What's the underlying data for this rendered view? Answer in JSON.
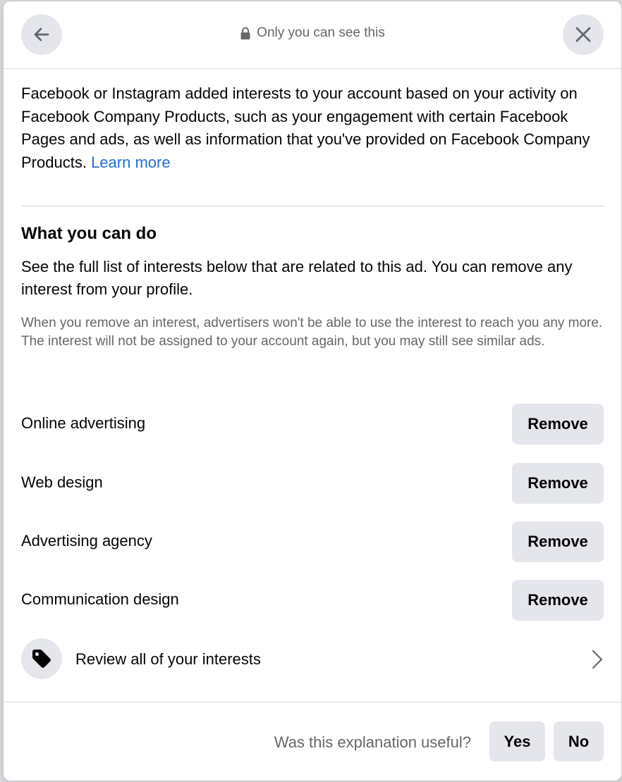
{
  "header": {
    "title": "Only you can see this",
    "icons": {
      "back": "arrow-left-icon",
      "lock": "lock-icon",
      "close": "close-icon"
    }
  },
  "intro": {
    "text": "Facebook or Instagram added interests to your account based on your activity on Facebook Company Products, such as your engagement with certain Facebook Pages and ads, as well as information that you've provided on Facebook Company Products.",
    "link": "Learn more"
  },
  "what_you_can_do": {
    "title": "What you can do",
    "description": "See the full list of interests below that are related to this ad. You can remove any interest from your profile.",
    "note": "When you remove an interest, advertisers won't be able to use the interest to reach you any more. The interest will not be assigned to your account again, but you may still see similar ads."
  },
  "interests": [
    {
      "label": "Online advertising",
      "button": "Remove"
    },
    {
      "label": "Web design",
      "button": "Remove"
    },
    {
      "label": "Advertising agency",
      "button": "Remove"
    },
    {
      "label": "Communication design",
      "button": "Remove"
    }
  ],
  "review": {
    "label": "Review all of your interests",
    "icon": "tag-icon"
  },
  "footer": {
    "question": "Was this explanation useful?",
    "yes": "Yes",
    "no": "No"
  },
  "colors": {
    "link": "#216fdb",
    "button_bg": "#e4e6eb",
    "secondary_text": "#65676b",
    "primary_text": "#050505"
  }
}
